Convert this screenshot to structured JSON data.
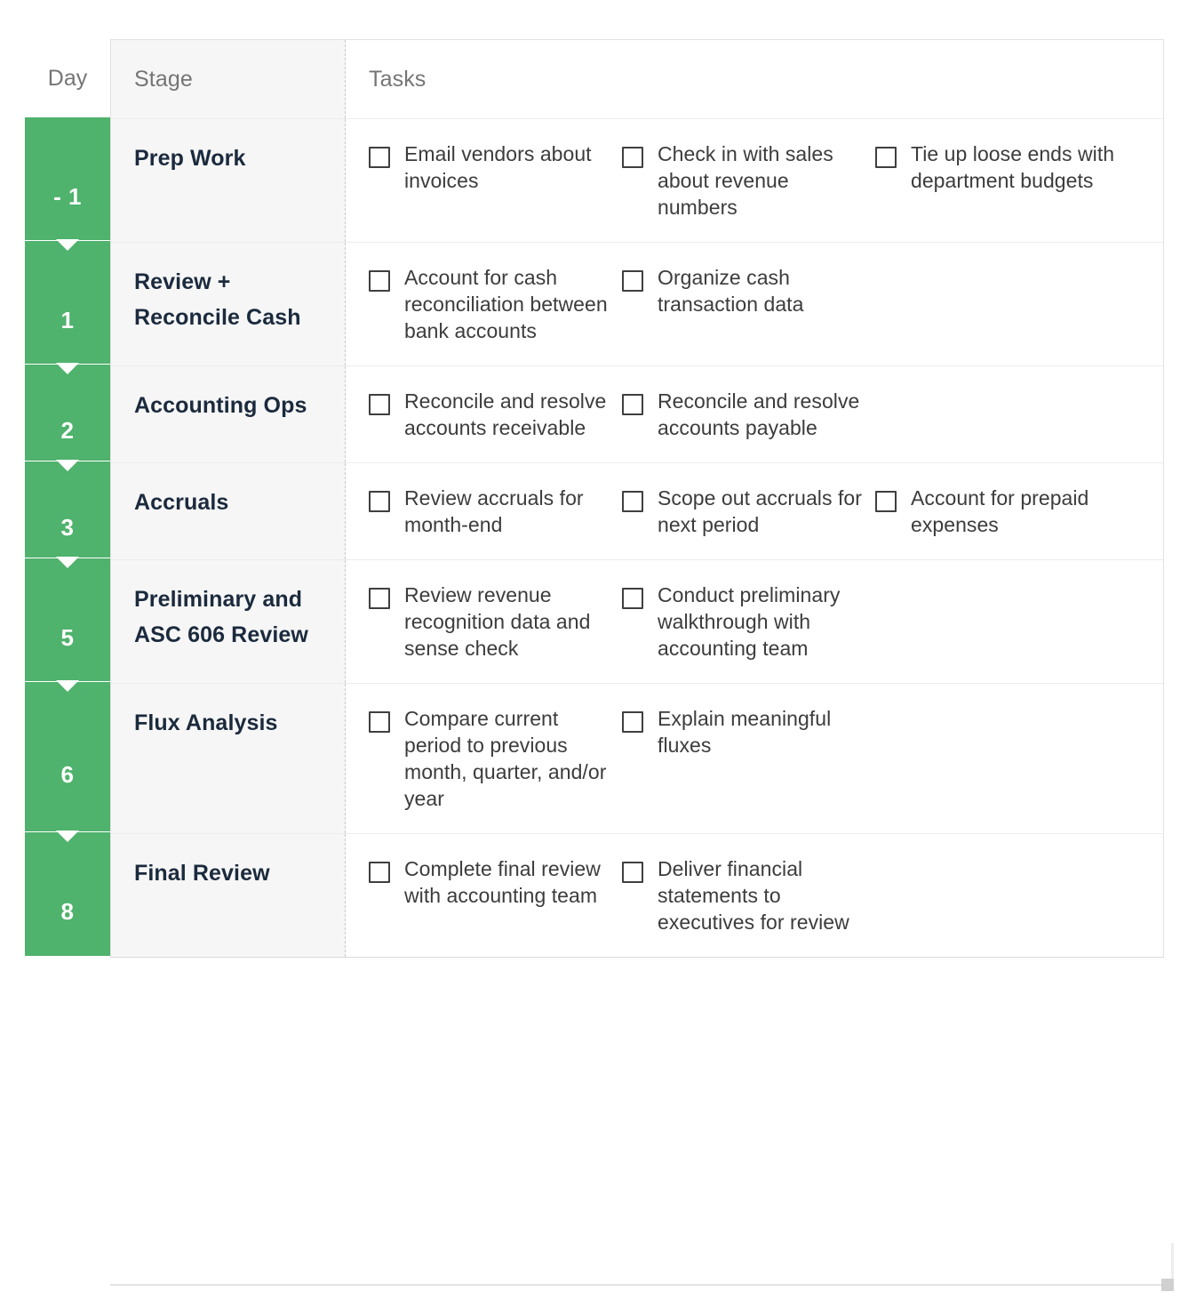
{
  "headers": {
    "day": "Day",
    "stage": "Stage",
    "tasks": "Tasks"
  },
  "colors": {
    "rail_green": "#4fb26d",
    "stage_cell_bg": "#f6f6f6",
    "header_text": "#757575",
    "stage_text": "#1b2a3d",
    "task_text": "#3c3c3c",
    "checkbox_border": "#3f3f3f"
  },
  "rows": [
    {
      "day": "- 1",
      "stage": "Prep Work",
      "tasks": [
        "Email vendors about invoices",
        "Check in with sales about revenue numbers",
        "Tie up loose ends with department budgets"
      ]
    },
    {
      "day": "1",
      "stage": "Review + Reconcile Cash",
      "tasks": [
        "Account for cash reconciliation between bank accounts",
        "Organize cash transaction data"
      ]
    },
    {
      "day": "2",
      "stage": "Accounting Ops",
      "tasks": [
        "Reconcile and resolve accounts receivable",
        "Reconcile and resolve accounts payable"
      ]
    },
    {
      "day": "3",
      "stage": "Accruals",
      "tasks": [
        "Review accruals for month-end",
        "Scope out accruals for next period",
        "Account for prepaid expenses"
      ]
    },
    {
      "day": "5",
      "stage": "Preliminary and ASC 606 Review",
      "tasks": [
        "Review revenue recognition data and sense check",
        "Conduct preliminary walkthrough with accounting team"
      ]
    },
    {
      "day": "6",
      "stage": "Flux Analysis",
      "tasks": [
        "Compare current period to previous month, quarter, and/or year",
        "Explain meaningful fluxes"
      ]
    },
    {
      "day": "8",
      "stage": "Final Review",
      "tasks": [
        "Complete final review with accounting team",
        "Deliver financial statements to executives for review"
      ]
    }
  ]
}
